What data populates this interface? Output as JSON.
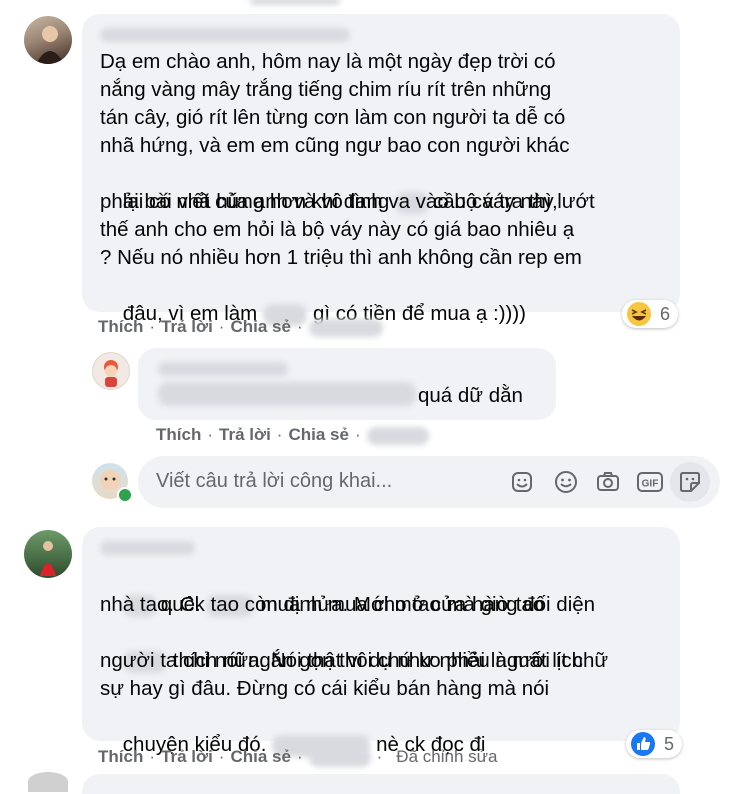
{
  "comments": [
    {
      "text_lines": [
        "Dạ em chào anh, hôm nay là một ngày đẹp trời có",
        "nắng vàng mây trắng tiếng chim ríu rít trên những",
        "tán cây, gió rít lên từng cơn làm con người ta dễ có",
        "nhã hứng, và em em cũng ngư bao con người khác",
        [
          "lại có nhã hứng hơn khi đang ",
          "cầu cá tra thì lướt"
        ],
        "phải bài viết của anh và vô tình va vào bộ váy này,",
        "thế anh cho em hỏi là bộ váy này có giá bao nhiêu ạ",
        "? Nếu nó nhiều hơn 1 triệu thì anh không cần rep em",
        [
          "đâu, vì em làm ",
          "gì có tiền để mua ạ :))))"
        ]
      ],
      "actions": {
        "like": "Thích",
        "reply": "Trả lời",
        "share": "Chia sẻ"
      },
      "reaction_count": "6",
      "reaction_icon": "haha-emoji-icon"
    }
  ],
  "reply": {
    "text_tail": "quá dữ dằn",
    "actions": {
      "like": "Thích",
      "reply": "Trả lời",
      "share": "Chia sẻ"
    }
  },
  "reply_box": {
    "placeholder": "Viết câu trả lời công khai...",
    "icons": [
      "sticker-icon",
      "emoji-icon",
      "camera-icon",
      "gif-icon",
      "sticker-face-icon"
    ]
  },
  "comment2": {
    "line1": [
      "quê. ",
      "mua nửa. Mới mở cửa hàng đối diện"
    ],
    "line2": "nhà tao. Ck tao còn định mua cho tao mà giờ tao",
    "line3": "thích nữa. Nói thật ví dụ như nhiều người ít chữ",
    "line4": "người ta chỉ nói ngắn gọn thôi chứ ko phải là mất lịch",
    "line5": "sự hay gì đâu. Đừng có cái kiểu bán hàng mà nói",
    "line6": [
      "chuyện kiểu đó. ",
      "nè ck đọc đi"
    ],
    "actions": {
      "like": "Thích",
      "reply": "Trả lời",
      "share": "Chia sẻ",
      "edited": "Đã chỉnh sửa"
    },
    "reaction_count": "5",
    "reaction_icon": "like-icon"
  },
  "colors": {
    "bubble": "#f0f2f5",
    "meta": "#65676b",
    "like_blue": "#1877f2",
    "online": "#31a24c"
  }
}
